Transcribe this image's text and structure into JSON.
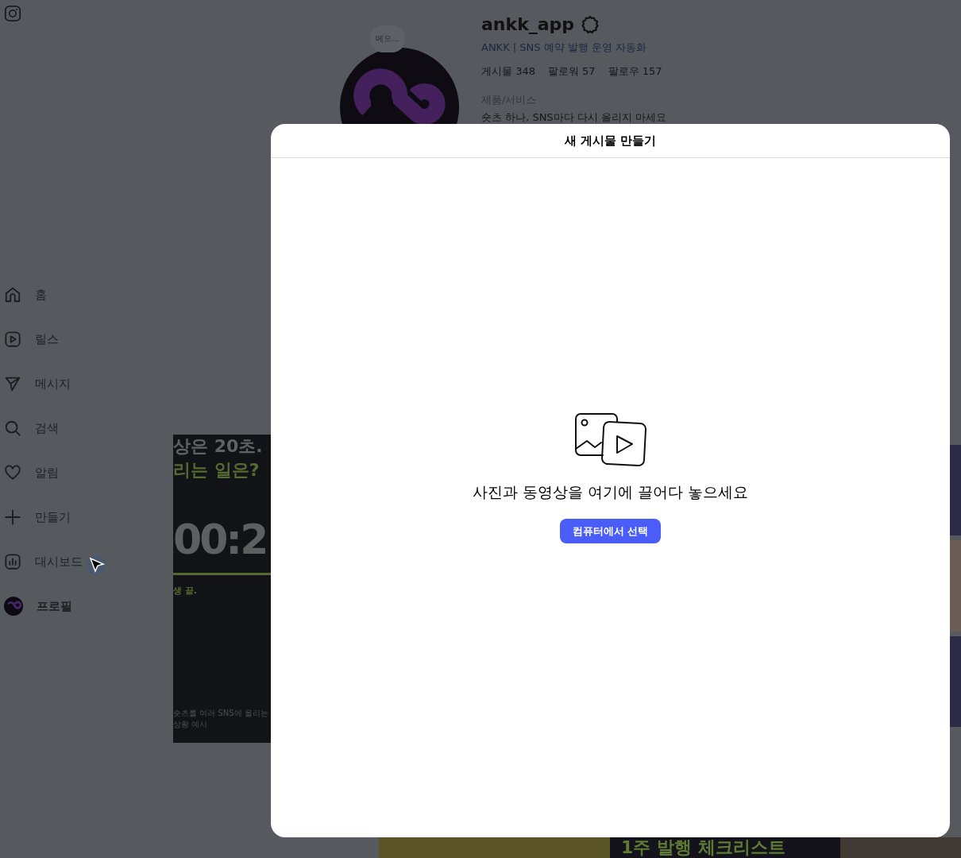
{
  "sidebar": {
    "items": [
      {
        "label": "홈",
        "kind": "home",
        "selected": false
      },
      {
        "label": "릴스",
        "kind": "reels",
        "selected": false
      },
      {
        "label": "메시지",
        "kind": "messages",
        "selected": false
      },
      {
        "label": "검색",
        "kind": "search",
        "selected": false
      },
      {
        "label": "알림",
        "kind": "notifications",
        "selected": false
      },
      {
        "label": "만들기",
        "kind": "create",
        "selected": false
      },
      {
        "label": "대시보드",
        "kind": "dashboard",
        "selected": false
      },
      {
        "label": "프로필",
        "kind": "profile",
        "selected": true
      }
    ]
  },
  "profile": {
    "note": "메모...",
    "username": "ankk_app",
    "bio": "ANKK | SNS 예약 발행 운영 자동화",
    "stats": [
      "게시물 348",
      "팔로워 57",
      "팔로우 157"
    ],
    "category": "제품/서비스",
    "description": "숏츠 하나, SNS마다 다시 올리지 마세요"
  },
  "posts": {
    "headline_1": "상은 20초.",
    "headline_2": "리는 일은?",
    "timer": "00:2",
    "caption": "생 끝.",
    "footnote": "숏츠를 여러 SNS에 올리는 상황 예시",
    "checklist_title": "1주 발행 체크리스트"
  },
  "modal": {
    "title": "새 게시물 만들기",
    "prompt": "사진과 동영상을 여기에 끌어다 놓으세요",
    "button": "컴퓨터에서 선택"
  }
}
